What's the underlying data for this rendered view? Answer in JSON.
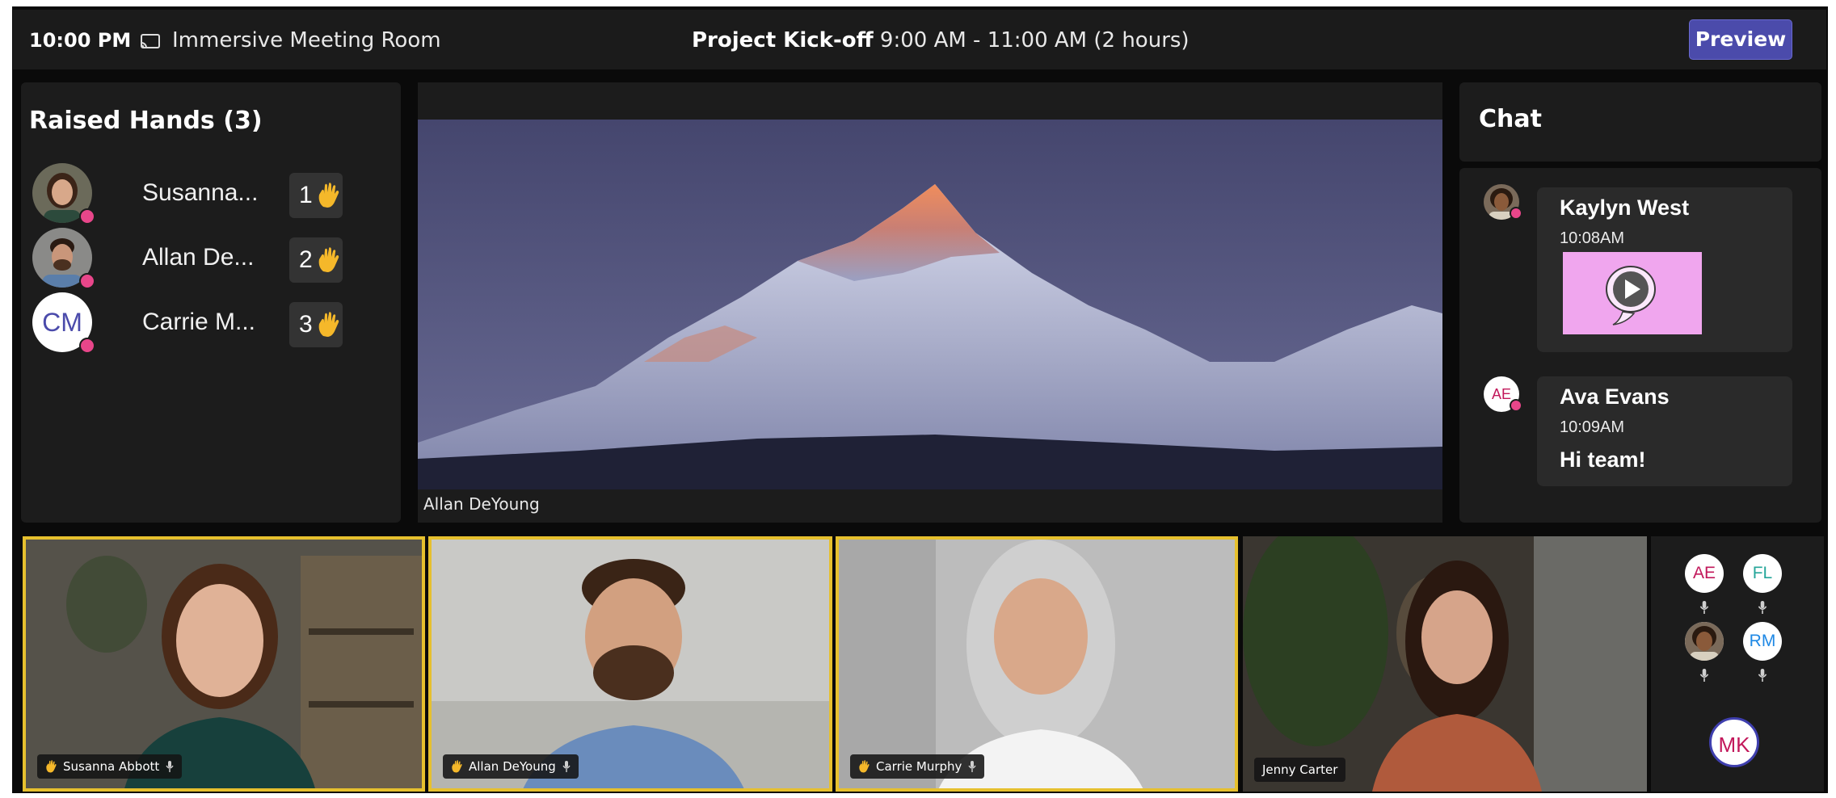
{
  "header": {
    "time": "10:00 PM",
    "room_icon": "cast-screen-icon",
    "room_name": "Immersive Meeting Room",
    "meeting_title": "Project Kick-off",
    "meeting_time": "9:00 AM - 11:00 AM (2 hours)",
    "preview_label": "Preview"
  },
  "raised_hands": {
    "title": "Raised Hands (3)",
    "items": [
      {
        "name": "Susanna...",
        "order": "1",
        "avatar": "photo",
        "hand_icon": "raised-hand-icon"
      },
      {
        "name": "Allan De...",
        "order": "2",
        "avatar": "photo",
        "hand_icon": "raised-hand-icon"
      },
      {
        "name": "Carrie M...",
        "order": "3",
        "avatar": "CM",
        "hand_icon": "raised-hand-icon"
      }
    ]
  },
  "stage": {
    "speaker_caption": "Allan DeYoung",
    "content": "mountain-landscape-image"
  },
  "chat": {
    "title": "Chat",
    "messages": [
      {
        "sender": "Kaylyn West",
        "time": "10:08AM",
        "attachment": "gif-play-icon",
        "avatar": "photo"
      },
      {
        "sender": "Ava Evans",
        "time": "10:09AM",
        "text": "Hi team!",
        "avatar": "AE"
      }
    ]
  },
  "participants": [
    {
      "name": "Susanna Abbott",
      "hand_raised": true,
      "mic_icon": "mic-muted-icon"
    },
    {
      "name": "Allan DeYoung",
      "hand_raised": true,
      "mic_icon": "mic-muted-icon"
    },
    {
      "name": "Carrie Murphy",
      "hand_raised": true,
      "mic_icon": "mic-muted-icon"
    },
    {
      "name": "Jenny Carter",
      "hand_raised": false
    }
  ],
  "roster": [
    {
      "initials": "AE",
      "color": "#c2185b"
    },
    {
      "initials": "FL",
      "color": "#26a69a"
    },
    {
      "initials": "",
      "avatar": "photo"
    },
    {
      "initials": "RM",
      "color": "#1e88e5"
    },
    {
      "initials": "MK",
      "color": "#c2185b"
    }
  ],
  "colors": {
    "raised_border": "#e6c02e",
    "hand": "#f5b82a",
    "presence_dot": "#e8468a",
    "preview_button": "#4b4bab"
  }
}
